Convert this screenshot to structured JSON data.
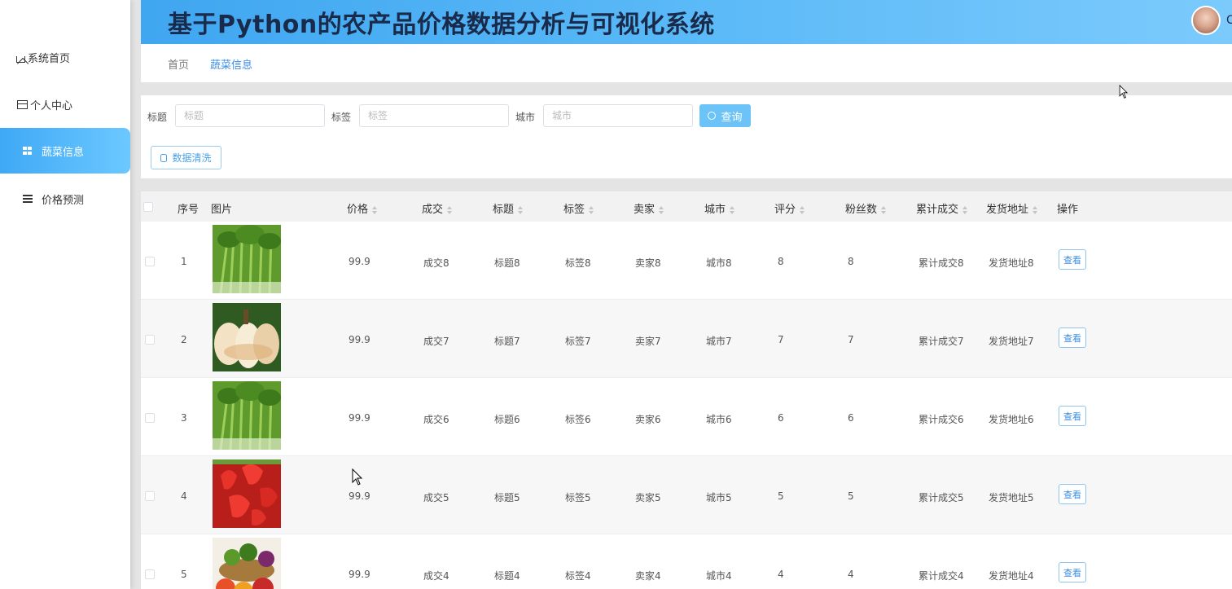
{
  "sidebar": {
    "items": [
      {
        "label": "系统首页",
        "icon": "home-icon"
      },
      {
        "label": "个人中心",
        "icon": "card-icon"
      },
      {
        "label": "蔬菜信息",
        "icon": "grid-icon",
        "active": true
      },
      {
        "label": "价格预测",
        "icon": "list-icon"
      }
    ]
  },
  "header": {
    "title": "基于Python的农产品价格数据分析与可视化系统",
    "user_initial": "C"
  },
  "breadcrumb": {
    "home": "首页",
    "current": "蔬菜信息"
  },
  "search": {
    "title_label": "标题",
    "title_placeholder": "标题",
    "tag_label": "标签",
    "tag_placeholder": "标签",
    "city_label": "城市",
    "city_placeholder": "城市",
    "query_button": "查询",
    "clean_button": "数据清洗"
  },
  "table": {
    "headers": {
      "index": "序号",
      "image": "图片",
      "price": "价格",
      "deal": "成交",
      "title": "标题",
      "tag": "标签",
      "seller": "卖家",
      "city": "城市",
      "rating": "评分",
      "fans": "粉丝数",
      "total_deal": "累计成交",
      "ship_addr": "发货地址",
      "action": "操作"
    },
    "rows": [
      {
        "index": "1",
        "image": "celery",
        "price": "99.9",
        "deal": "成交8",
        "title": "标题8",
        "tag": "标签8",
        "seller": "卖家8",
        "city": "城市8",
        "rating": "8",
        "fans": "8",
        "total_deal": "累计成交8",
        "ship_addr": "发货地址8",
        "action": "查看"
      },
      {
        "index": "2",
        "image": "pumpkin",
        "price": "99.9",
        "deal": "成交7",
        "title": "标题7",
        "tag": "标签7",
        "seller": "卖家7",
        "city": "城市7",
        "rating": "7",
        "fans": "7",
        "total_deal": "累计成交7",
        "ship_addr": "发货地址7",
        "action": "查看"
      },
      {
        "index": "3",
        "image": "celery",
        "price": "99.9",
        "deal": "成交6",
        "title": "标题6",
        "tag": "标签6",
        "seller": "卖家6",
        "city": "城市6",
        "rating": "6",
        "fans": "6",
        "total_deal": "累计成交6",
        "ship_addr": "发货地址6",
        "action": "查看"
      },
      {
        "index": "4",
        "image": "strawberry",
        "price": "99.9",
        "deal": "成交5",
        "title": "标题5",
        "tag": "标签5",
        "seller": "卖家5",
        "city": "城市5",
        "rating": "5",
        "fans": "5",
        "total_deal": "累计成交5",
        "ship_addr": "发货地址5",
        "action": "查看"
      },
      {
        "index": "5",
        "image": "vegetable-basket",
        "price": "99.9",
        "deal": "成交4",
        "title": "标题4",
        "tag": "标签4",
        "seller": "卖家4",
        "city": "城市4",
        "rating": "4",
        "fans": "4",
        "total_deal": "累计成交4",
        "ship_addr": "发货地址4",
        "action": "查看"
      }
    ]
  },
  "colors": {
    "accent": "#3a8ee6",
    "header_gradient_start": "#3fa6f0",
    "header_gradient_end": "#7ccafc",
    "query_button": "#6cc3f7"
  }
}
